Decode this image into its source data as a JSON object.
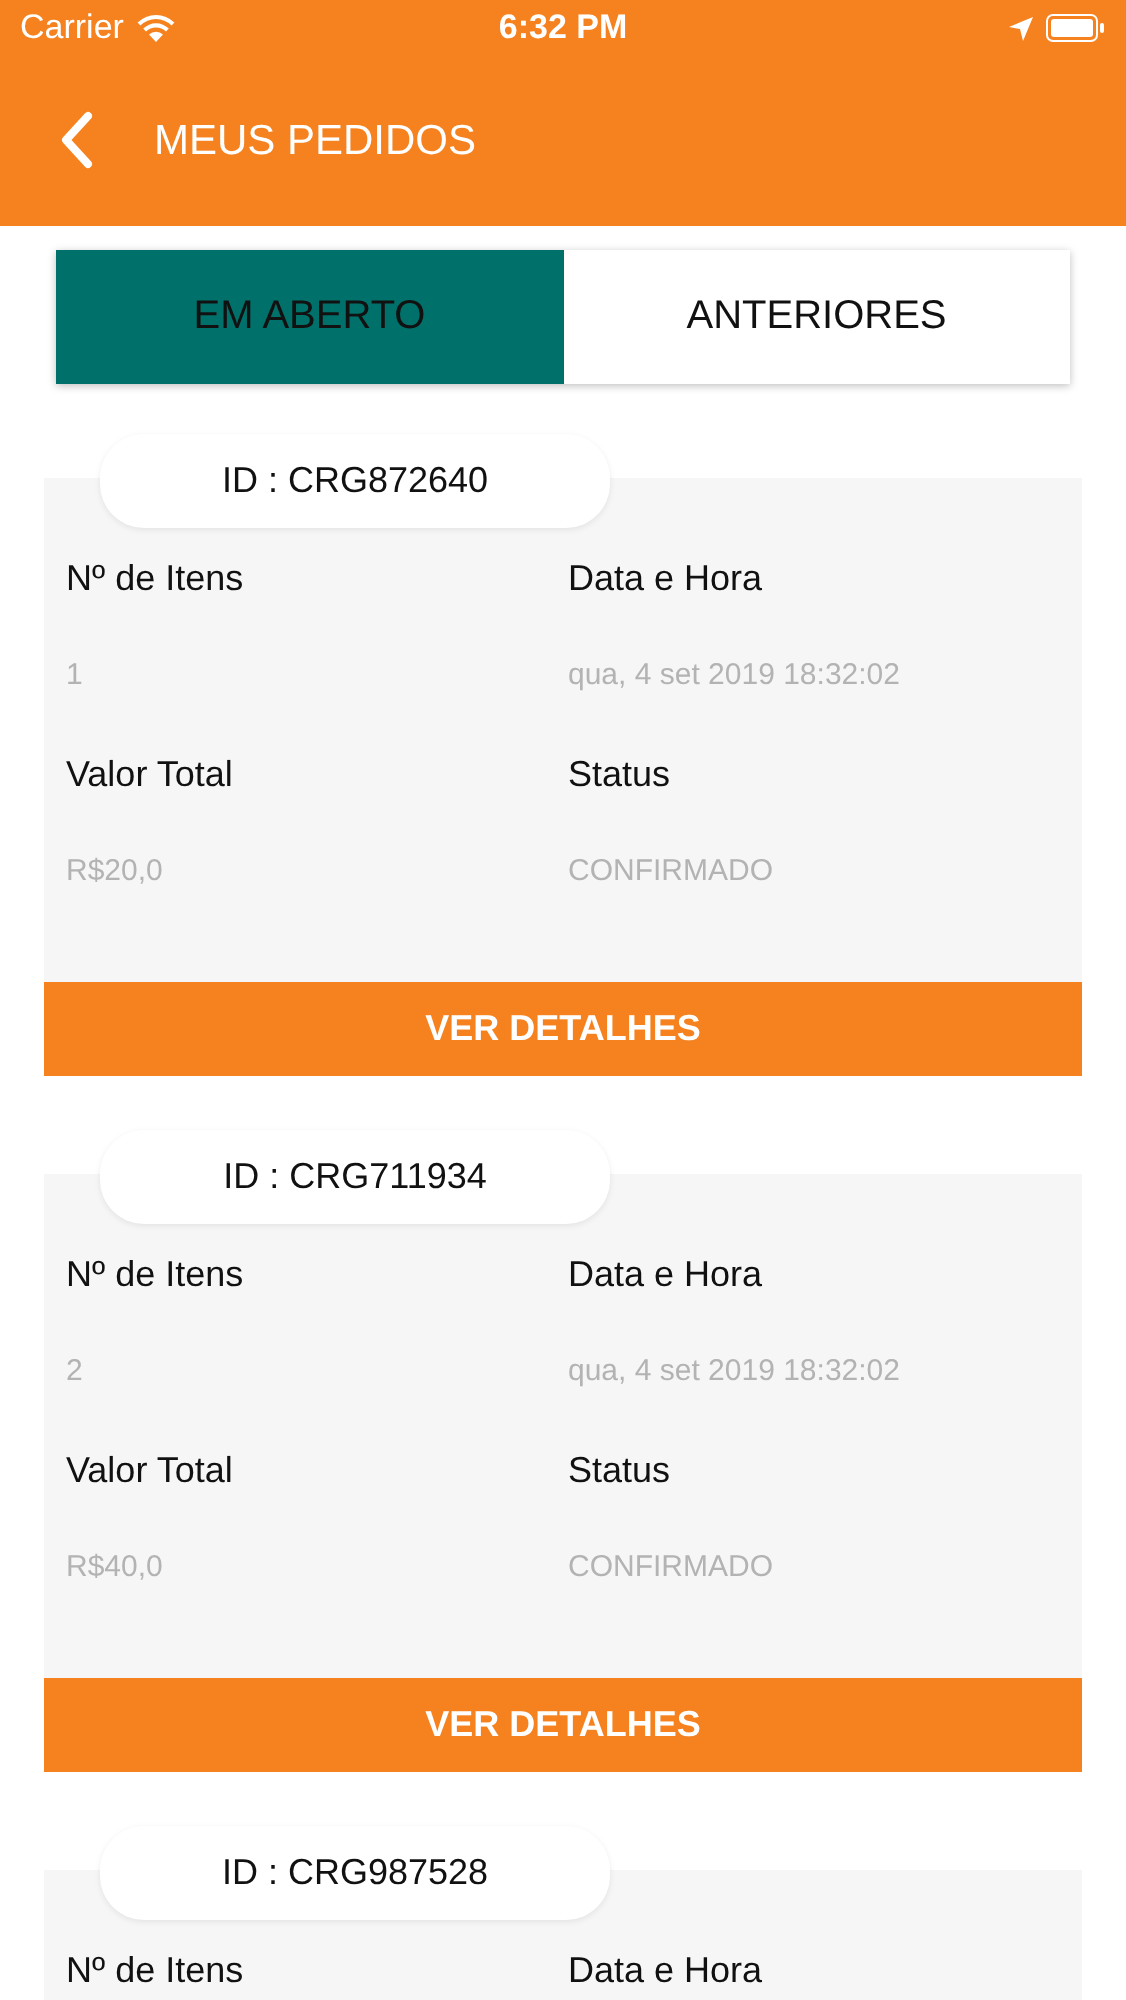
{
  "status_bar": {
    "carrier": "Carrier",
    "time": "6:32 PM"
  },
  "header": {
    "title": "MEUS PEDIDOS"
  },
  "tabs": [
    {
      "label": "EM ABERTO",
      "selected": true
    },
    {
      "label": "ANTERIORES",
      "selected": false
    }
  ],
  "orders": [
    {
      "id": "ID : CRG872640",
      "items_label": "Nº de Itens",
      "date_label": "Data e Hora",
      "items": "1",
      "date": "qua, 4 set 2019 18:32:02",
      "total_label": "Valor Total",
      "status_label": "Status",
      "total": "R$20,0",
      "status": "CONFIRMADO",
      "button": "VER DETALHES"
    },
    {
      "id": "ID : CRG711934",
      "items_label": "Nº de Itens",
      "date_label": "Data e Hora",
      "items": "2",
      "date": "qua, 4 set 2019 18:32:02",
      "total_label": "Valor Total",
      "status_label": "Status",
      "total": "R$40,0",
      "status": "CONFIRMADO",
      "button": "VER DETALHES"
    },
    {
      "id": "ID : CRG987528",
      "items_label": "Nº de Itens",
      "date_label": "Data e Hora"
    }
  ]
}
